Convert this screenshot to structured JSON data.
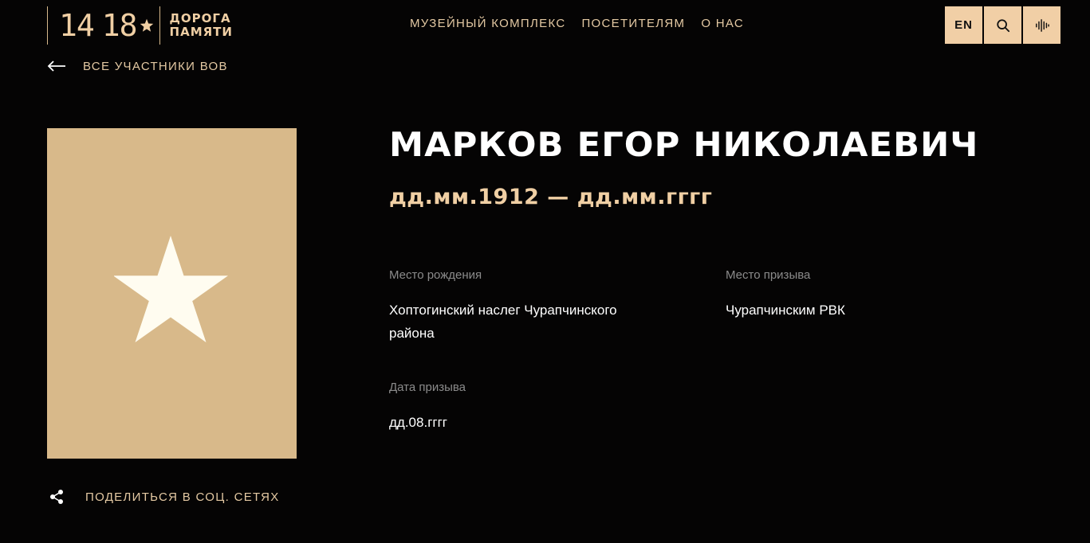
{
  "header": {
    "logo": {
      "number_left": "14",
      "number_right": "18",
      "text_line1": "ДОРОГА",
      "text_line2": "ПАМЯТИ"
    },
    "nav": [
      {
        "label": "МУЗЕЙНЫЙ КОМПЛЕКС"
      },
      {
        "label": "ПОСЕТИТЕЛЯМ"
      },
      {
        "label": "О НАС"
      }
    ],
    "lang_button": "EN",
    "search_icon": "search-icon",
    "audio_icon": "audio-wave-icon"
  },
  "back_link": {
    "label": "ВСЕ УЧАСТНИКИ ВОВ",
    "icon": "arrow-left-icon"
  },
  "portrait": {
    "icon": "star-icon"
  },
  "person": {
    "name": "МАРКОВ ЕГОР НИКОЛАЕВИЧ",
    "dates": "дд.мм.1912 — дд.мм.гггг",
    "fields": {
      "birth_place": {
        "label": "Место рождения",
        "value_line1": "Хоптогинский наслег Чурапчинского",
        "value_line2": "района"
      },
      "draft_place": {
        "label": "Место призыва",
        "value": "Чурапчинским РВК"
      },
      "draft_date": {
        "label": "Дата призыва",
        "value": "дд.08.гггг"
      }
    }
  },
  "share": {
    "label": "ПОДЕЛИТЬСЯ В СОЦ. СЕТЯХ",
    "icon": "share-icon"
  },
  "colors": {
    "background": "#050404",
    "accent": "#f0cfa4",
    "portrait_bg": "#d8b98a",
    "star": "#fffcf0",
    "label_gray": "#8b8b8b"
  }
}
